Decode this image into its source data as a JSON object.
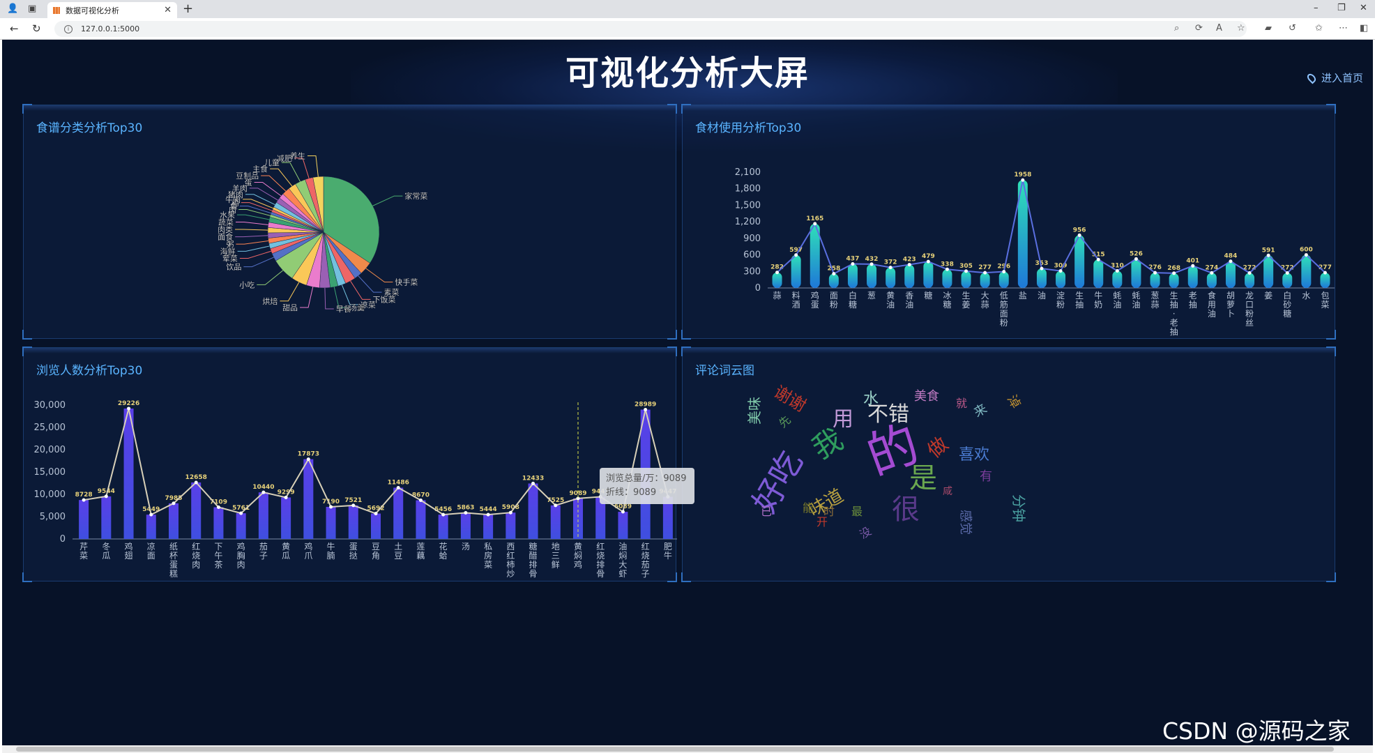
{
  "browser": {
    "tab_title": "数据可视化分析",
    "tab_close": "✕",
    "new_tab": "+",
    "url": "127.0.0.1:5000",
    "win_min": "–",
    "win_max": "❐",
    "win_close": "✕"
  },
  "dashboard": {
    "title": "可视化分析大屏",
    "home_link": "进入首页",
    "watermark": "CSDN @源码之家"
  },
  "panels": {
    "pie": {
      "title": "食谱分类分析Top30"
    },
    "ingredients": {
      "title": "食材使用分析Top30"
    },
    "views": {
      "title": "浏览人数分析Top30"
    },
    "wordcloud": {
      "title": "评论词云图"
    }
  },
  "tooltip": {
    "line1": "浏览总量/万：9089",
    "line2": "折线：9089"
  },
  "chart_data": [
    {
      "type": "pie",
      "title": "食谱分类分析Top30",
      "labels": [
        "家常菜",
        "快手菜",
        "素菜",
        "下饭菜",
        "凉菜",
        "汤羹",
        "早餐",
        "甜品",
        "烘焙",
        "小吃",
        "饮品",
        "荤菜",
        "海鲜",
        "粥",
        "面食",
        "肉类",
        "蔬菜",
        "水果",
        "肉",
        "鱼",
        "鸡",
        "牛肉",
        "猪肉",
        "羊肉",
        "蛋",
        "豆制品",
        "主食",
        "儿童",
        "减肥",
        "养生"
      ],
      "segment_values": [
        45,
        5,
        3,
        4,
        3,
        3,
        4,
        5,
        6,
        9,
        3,
        2,
        2,
        2,
        2,
        2,
        2,
        2,
        1,
        1,
        1,
        1,
        2,
        2,
        2,
        3,
        3,
        4,
        3,
        4
      ],
      "colors": [
        "#4aac6f",
        "#f08a4b",
        "#5470c6",
        "#ee6666",
        "#73c0de",
        "#3ba272",
        "#9a60b4",
        "#ea7ccc",
        "#fac858",
        "#91cc75",
        "#5470c6",
        "#ee6666",
        "#73c0de",
        "#fc8452",
        "#9a60b4",
        "#fac858",
        "#ea7ccc",
        "#3ba272",
        "#91cc75",
        "#5470c6",
        "#ee6666",
        "#fac858",
        "#73c0de",
        "#9a60b4",
        "#ea7ccc",
        "#fc8452",
        "#fac858",
        "#91cc75",
        "#ee6666",
        "#f4d35e"
      ]
    },
    {
      "type": "bar",
      "title": "食材使用分析Top30",
      "categories": [
        "蒜",
        "料酒",
        "鸡蛋",
        "面粉",
        "白糖",
        "葱",
        "黄油",
        "香油",
        "糖",
        "冰糖",
        "生姜",
        "大蒜",
        "低筋面粉",
        "盐",
        "油",
        "淀粉",
        "生抽",
        "牛奶",
        "蚝油",
        "蚝油",
        "葱蒜",
        "生抽·老抽",
        "老抽",
        "食用油",
        "胡萝卜",
        "龙口粉丝",
        "姜",
        "白砂糖",
        "水",
        "包菜"
      ],
      "values": [
        282,
        597,
        1165,
        258,
        437,
        432,
        372,
        423,
        479,
        338,
        305,
        277,
        296,
        1958,
        353,
        309,
        956,
        515,
        310,
        526,
        276,
        268,
        401,
        274,
        484,
        272,
        591,
        272,
        600,
        277
      ],
      "ylim": [
        0,
        2100
      ],
      "yticks": [
        "0",
        "300",
        "600",
        "900",
        "1,200",
        "1,500",
        "1,800",
        "2,100"
      ]
    },
    {
      "type": "bar",
      "title": "浏览人数分析Top30",
      "categories": [
        "芹菜",
        "冬瓜",
        "鸡翅",
        "凉面",
        "纸杯蛋糕",
        "红烧肉",
        "下午茶",
        "鸡胸肉",
        "茄子",
        "黄瓜",
        "鸡爪",
        "牛腩",
        "蛋挞",
        "豆角",
        "土豆",
        "莲藕",
        "花蛤",
        "汤",
        "私房菜",
        "西红柿炒",
        "糖醋排骨",
        "地三鲜",
        "黄焖鸡",
        "红烧排骨",
        "油焖大虾",
        "红烧茄子",
        "肥牛"
      ],
      "values": [
        8728,
        9544,
        29226,
        5449,
        7985,
        12658,
        7109,
        5761,
        10440,
        9299,
        17873,
        7190,
        7521,
        5692,
        11486,
        8670,
        5456,
        5863,
        5444,
        5908,
        12433,
        7525,
        9089,
        9447,
        6089,
        28989,
        9447
      ],
      "ylim": [
        0,
        30000
      ],
      "yticks": [
        "0",
        "5,000",
        "10,000",
        "15,000",
        "20,000",
        "25,000",
        "30,000"
      ]
    }
  ],
  "wordcloud": [
    {
      "t": "的",
      "c": "#a44bd2"
    },
    {
      "t": "好吃",
      "c": "#7e5bd6"
    },
    {
      "t": "我",
      "c": "#2f9d5e"
    },
    {
      "t": "是",
      "c": "#6aa84f"
    },
    {
      "t": "不错",
      "c": "#d9d9d9"
    },
    {
      "t": "用",
      "c": "#c29ad8"
    },
    {
      "t": "很",
      "c": "#5a3a8a"
    },
    {
      "t": "做",
      "c": "#c0392b"
    },
    {
      "t": "喜欢",
      "c": "#4a7bd0"
    },
    {
      "t": "味道",
      "c": "#b8a040"
    },
    {
      "t": "美味",
      "c": "#7fc8a9"
    },
    {
      "t": "谢谢",
      "c": "#c0392b"
    },
    {
      "t": "美食",
      "c": "#c07ac2"
    },
    {
      "t": "水",
      "c": "#9ad0c7"
    },
    {
      "t": "分钟",
      "c": "#4aa0a0"
    },
    {
      "t": "有",
      "c": "#7a3d9a"
    },
    {
      "t": "感觉",
      "c": "#5a6aa8"
    },
    {
      "t": "就",
      "c": "#c05a8a"
    },
    {
      "t": "来",
      "c": "#7fb8c2"
    },
    {
      "t": "已",
      "c": "#b071c9"
    },
    {
      "t": "开",
      "c": "#c0392b"
    },
    {
      "t": "时",
      "c": "#8d6e3a"
    },
    {
      "t": "最",
      "c": "#6a8d3a"
    },
    {
      "t": "能",
      "c": "#7a7a2a"
    },
    {
      "t": "淖",
      "c": "#c09030"
    },
    {
      "t": "没",
      "c": "#7a5aa8"
    },
    {
      "t": "先",
      "c": "#5a9a5a"
    },
    {
      "t": "咸",
      "c": "#a84a6a"
    }
  ]
}
